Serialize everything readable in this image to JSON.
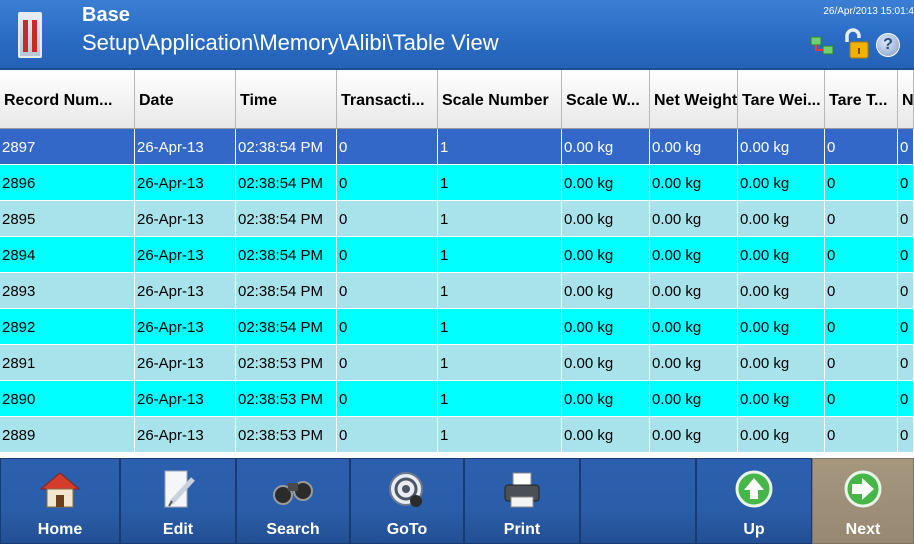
{
  "header": {
    "title": "Base",
    "breadcrumb": "Setup\\Application\\Memory\\Alibi\\Table View",
    "datetime": "26/Apr/2013 15:01:4",
    "help_symbol": "?"
  },
  "table": {
    "columns": [
      "Record Num...",
      "Date",
      "Time",
      "Transacti...",
      "Scale Number",
      "Scale W...",
      "Net Weight",
      "Tare Wei...",
      "Tare T...",
      "N"
    ],
    "rows": [
      [
        "2897",
        "26-Apr-13",
        "02:38:54 PM",
        "0",
        "1",
        "0.00 kg",
        "0.00 kg",
        "0.00 kg",
        "0",
        "0"
      ],
      [
        "2896",
        "26-Apr-13",
        "02:38:54 PM",
        "0",
        "1",
        "0.00 kg",
        "0.00 kg",
        "0.00 kg",
        "0",
        "0"
      ],
      [
        "2895",
        "26-Apr-13",
        "02:38:54 PM",
        "0",
        "1",
        "0.00 kg",
        "0.00 kg",
        "0.00 kg",
        "0",
        "0"
      ],
      [
        "2894",
        "26-Apr-13",
        "02:38:54 PM",
        "0",
        "1",
        "0.00 kg",
        "0.00 kg",
        "0.00 kg",
        "0",
        "0"
      ],
      [
        "2893",
        "26-Apr-13",
        "02:38:54 PM",
        "0",
        "1",
        "0.00 kg",
        "0.00 kg",
        "0.00 kg",
        "0",
        "0"
      ],
      [
        "2892",
        "26-Apr-13",
        "02:38:54 PM",
        "0",
        "1",
        "0.00 kg",
        "0.00 kg",
        "0.00 kg",
        "0",
        "0"
      ],
      [
        "2891",
        "26-Apr-13",
        "02:38:53 PM",
        "0",
        "1",
        "0.00 kg",
        "0.00 kg",
        "0.00 kg",
        "0",
        "0"
      ],
      [
        "2890",
        "26-Apr-13",
        "02:38:53 PM",
        "0",
        "1",
        "0.00 kg",
        "0.00 kg",
        "0.00 kg",
        "0",
        "0"
      ],
      [
        "2889",
        "26-Apr-13",
        "02:38:53 PM",
        "0",
        "1",
        "0.00 kg",
        "0.00 kg",
        "0.00 kg",
        "0",
        "0"
      ]
    ],
    "selected_row": 0
  },
  "colors": {
    "header_blue": "#2a6cc4",
    "selected_row": "#3468c8",
    "row_cyan": "#00ffff",
    "row_pale": "#a8e2ea",
    "button_blue": "#2a5ea9",
    "button_next": "#978872"
  },
  "toolbar": {
    "buttons": [
      {
        "label": "Home",
        "icon": "home-icon"
      },
      {
        "label": "Edit",
        "icon": "edit-icon"
      },
      {
        "label": "Search",
        "icon": "binoculars-icon"
      },
      {
        "label": "GoTo",
        "icon": "goto-icon"
      },
      {
        "label": "Print",
        "icon": "printer-icon"
      },
      {
        "label": "",
        "icon": ""
      },
      {
        "label": "Up",
        "icon": "up-arrow-icon"
      },
      {
        "label": "Next",
        "icon": "next-arrow-icon"
      }
    ]
  }
}
